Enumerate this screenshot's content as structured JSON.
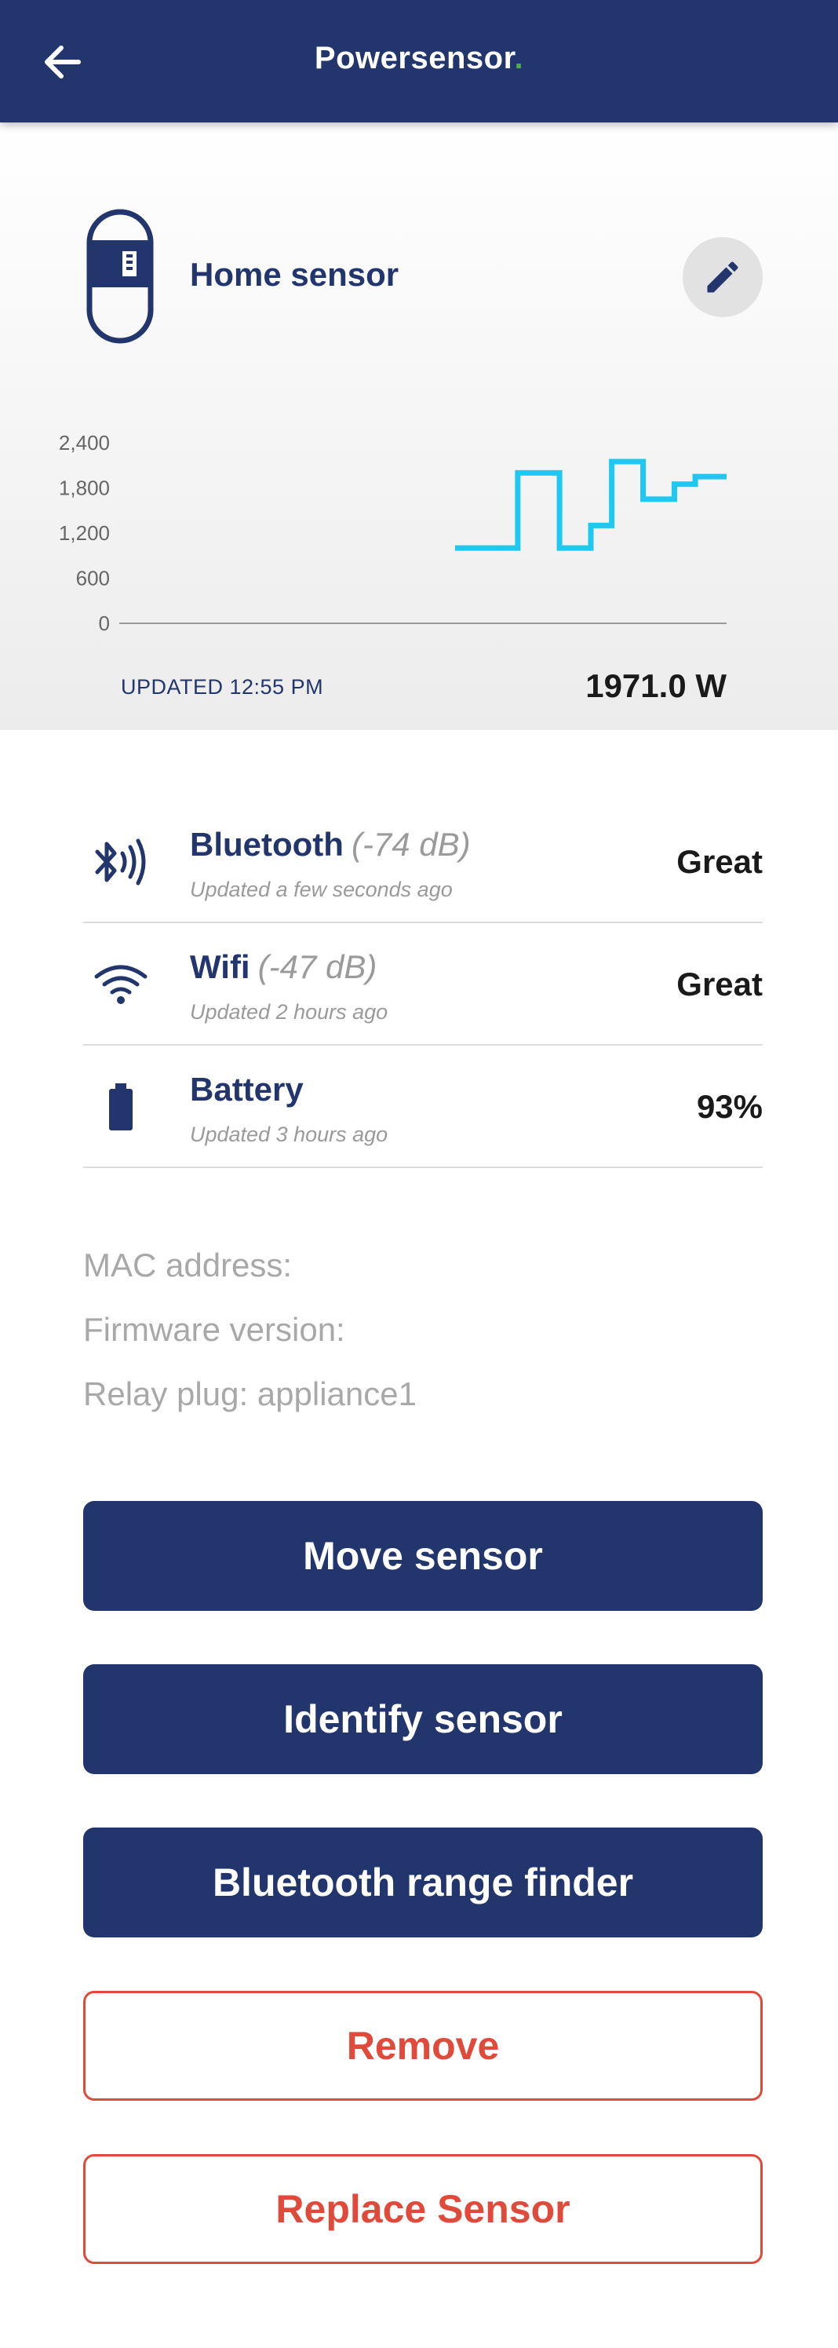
{
  "header": {
    "title": "Powersensor",
    "title_dot": "."
  },
  "sensor": {
    "name": "Home sensor"
  },
  "chart_data": {
    "type": "line",
    "yticks": [
      "2,400",
      "1,800",
      "1,200",
      "600",
      "0"
    ],
    "ylim": [
      0,
      2400
    ],
    "x": [
      0,
      1,
      2,
      3,
      4,
      5,
      6,
      7,
      8,
      9,
      10,
      11,
      12,
      13,
      14,
      15,
      16,
      17,
      18,
      19,
      20
    ],
    "values": [
      1000,
      1000,
      1000,
      1000,
      1000,
      1000,
      2000,
      2000,
      2000,
      2000,
      1000,
      1000,
      1000,
      1300,
      1300,
      2150,
      2150,
      2150,
      1650,
      1650,
      1650,
      1850,
      1850,
      1950,
      1950,
      1950,
      1950
    ],
    "grid": false
  },
  "hero": {
    "updated": "UPDATED 12:55 PM",
    "power": "1971.0 W"
  },
  "status": [
    {
      "name": "Bluetooth",
      "db": "(-74 dB)",
      "sub": "Updated a few seconds ago",
      "value": "Great",
      "icon": "bluetooth-signal-icon"
    },
    {
      "name": "Wifi",
      "db": "(-47 dB)",
      "sub": "Updated 2 hours ago",
      "value": "Great",
      "icon": "wifi-icon"
    },
    {
      "name": "Battery",
      "db": "",
      "sub": "Updated 3 hours ago",
      "value": "93%",
      "icon": "battery-icon"
    }
  ],
  "info": {
    "mac": "MAC address:",
    "firmware": "Firmware version:",
    "relay": "Relay plug: appliance1"
  },
  "buttons": {
    "move": "Move sensor",
    "identify": "Identify sensor",
    "range": "Bluetooth range finder",
    "remove": "Remove",
    "replace": "Replace Sensor"
  },
  "colors": {
    "primary": "#22356c",
    "accent_dot": "#4caf50",
    "chart_line": "#1ec8f0",
    "danger": "#e04a3a"
  }
}
